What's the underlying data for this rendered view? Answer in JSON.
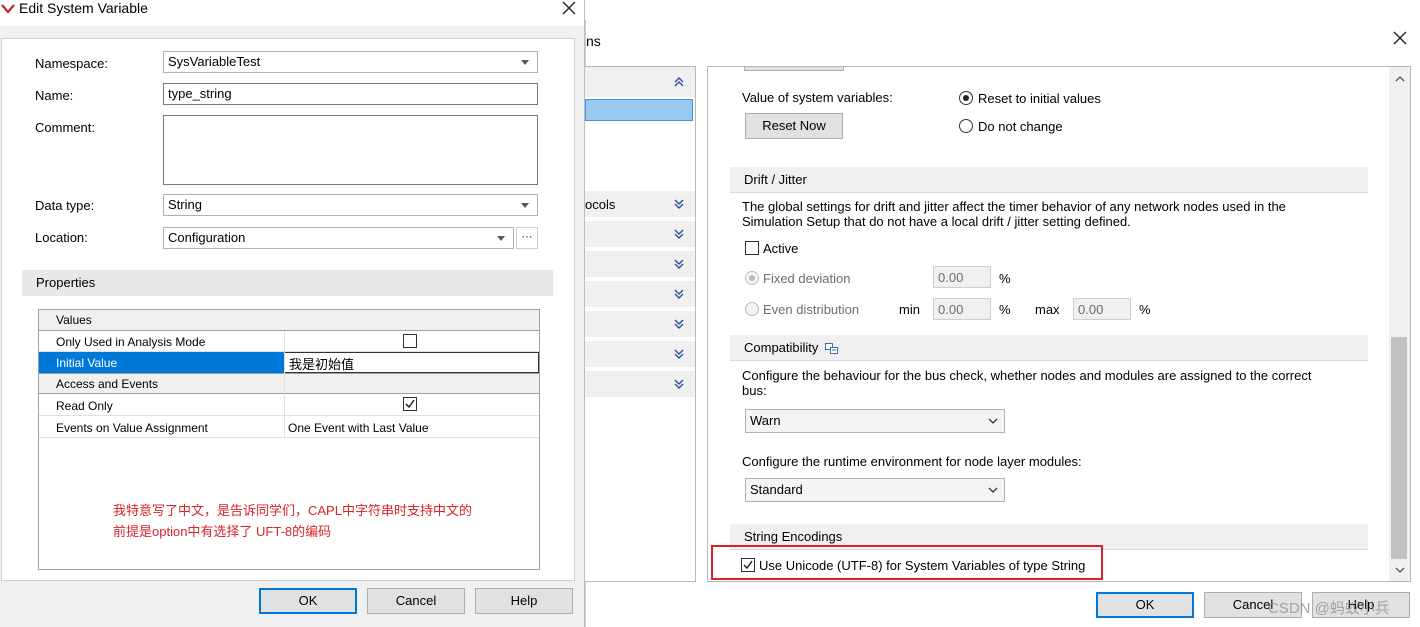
{
  "edit_dialog": {
    "title": "Edit System Variable",
    "namespace_label": "Namespace:",
    "namespace_value": "SysVariableTest",
    "name_label": "Name:",
    "name_value": "type_string",
    "comment_label": "Comment:",
    "comment_value": "",
    "datatype_label": "Data type:",
    "datatype_value": "String",
    "location_label": "Location:",
    "location_value": "Configuration",
    "location_browse": "···",
    "properties_header": "Properties",
    "grid": {
      "group_values": "Values",
      "row_analysis_label": "Only Used in Analysis Mode",
      "row_analysis_checked": false,
      "row_initial_label": "Initial Value",
      "row_initial_value": "我是初始值",
      "group_access": "Access and Events",
      "row_readonly_label": "Read Only",
      "row_readonly_checked": true,
      "row_events_label": "Events on Value Assignment",
      "row_events_value": "One Event with Last Value"
    },
    "annotation_line1": "我特意写了中文，是告诉同学们，CAPL中字符串时支持中文的",
    "annotation_line2": "前提是option中有选择了 UFT-8的编码",
    "ok_label": "OK",
    "cancel_label": "Cancel",
    "help_label": "Help"
  },
  "options_window": {
    "title_partial": "ns",
    "nav_items": [
      {
        "label": "",
        "selected": true
      },
      {
        "label": "ocols",
        "selected": false
      },
      {
        "label": "",
        "selected": false
      },
      {
        "label": "",
        "selected": false
      },
      {
        "label": "",
        "selected": false
      },
      {
        "label": "",
        "selected": false
      },
      {
        "label": "",
        "selected": false
      },
      {
        "label": "",
        "selected": false
      }
    ],
    "value_of_sysvars_label": "Value of system variables:",
    "reset_now_label": "Reset Now",
    "radio_reset_label": "Reset to initial values",
    "radio_reset_checked": true,
    "radio_nochange_label": "Do not change",
    "drift": {
      "header": "Drift / Jitter",
      "desc_line1": "The global settings for drift and jitter affect the timer behavior of any network nodes used in the",
      "desc_line2": "Simulation Setup that do not have a local drift / jitter setting defined.",
      "active_label": "Active",
      "fixed_label": "Fixed deviation",
      "fixed_value": "0.00",
      "percent": "%",
      "even_label": "Even distribution",
      "min_label": "min",
      "min_value": "0.00",
      "max_label": "max",
      "max_value": "0.00"
    },
    "compat": {
      "header": "Compatibility",
      "bus_desc_line1": "Configure the behaviour for the bus check, whether nodes and modules are assigned to the correct",
      "bus_desc_line2": "bus:",
      "bus_value": "Warn",
      "runtime_desc": "Configure the runtime environment for node  layer modules:",
      "runtime_value": "Standard"
    },
    "encodings": {
      "header": "String Encodings",
      "utf8_label": "Use Unicode (UTF-8) for System Variables of type String",
      "utf8_checked": true,
      "highlight_color": "#d9232a"
    },
    "ok_label": "OK",
    "cancel_label": "Cancel",
    "help_label": "Help"
  },
  "watermark": "CSDN @蚂蚁小兵",
  "colors": {
    "selection": "#0078d7",
    "nav_selected": "#99c9ef",
    "annotation": "#d9232a",
    "dialog_bg": "#f0f0f0"
  }
}
